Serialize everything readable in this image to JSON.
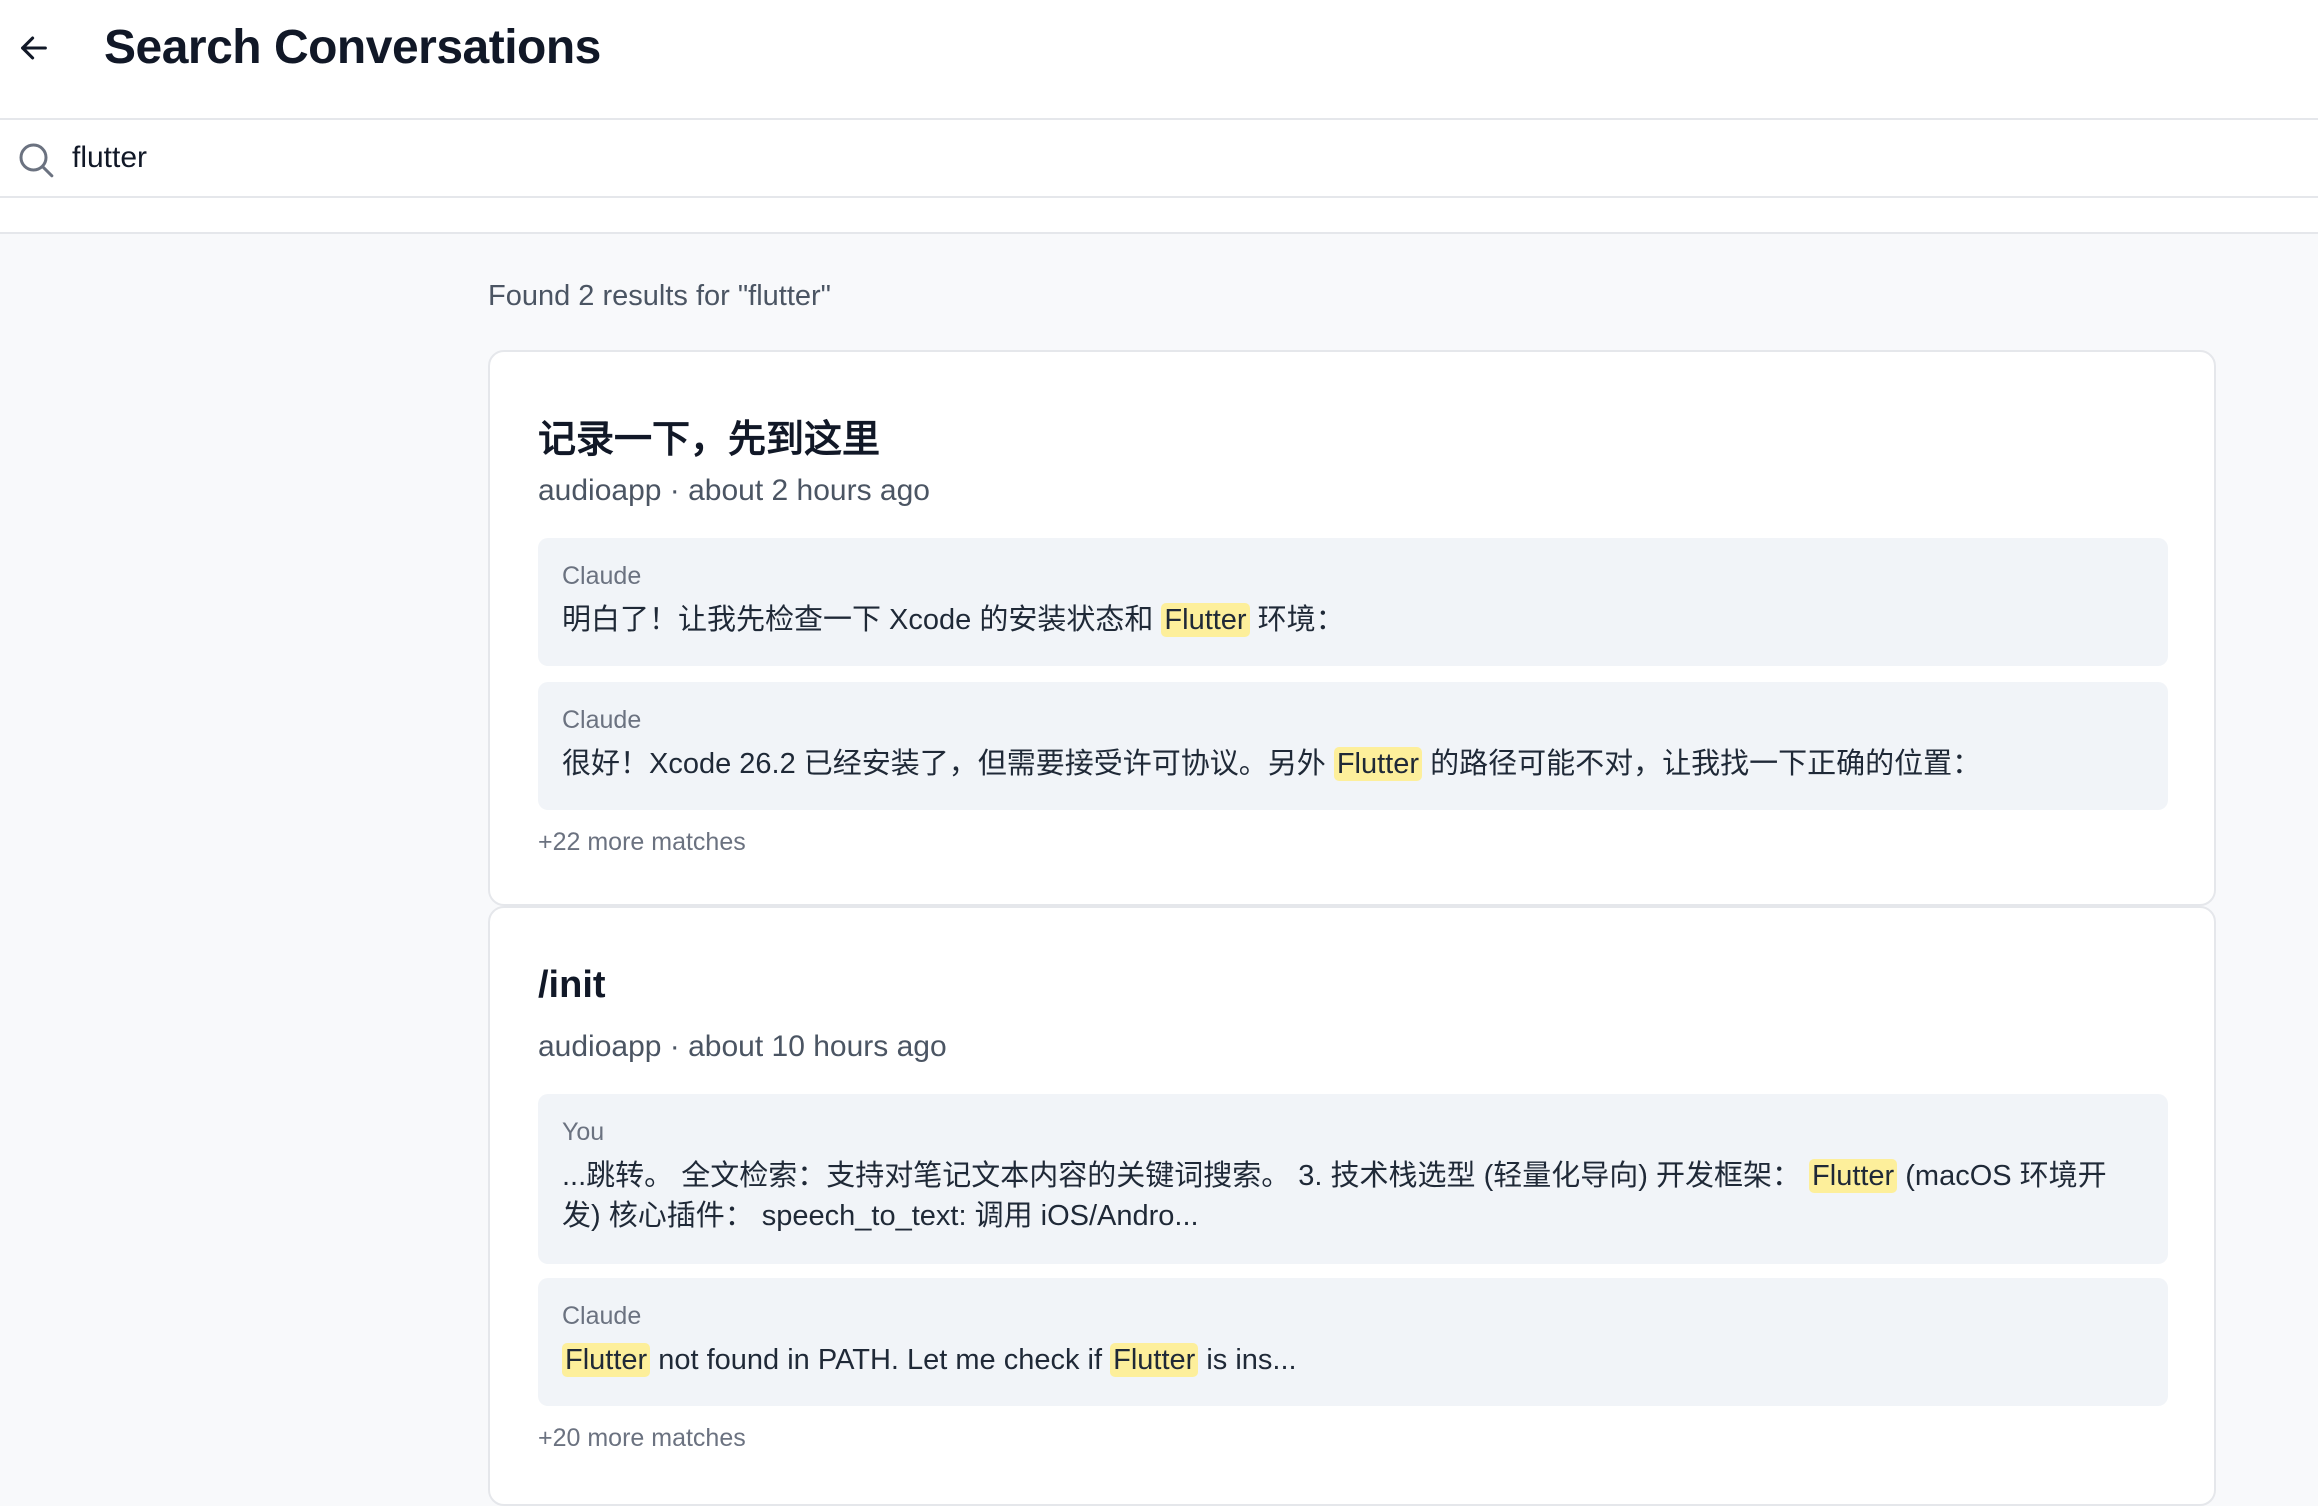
{
  "header": {
    "title": "Search Conversations",
    "back_icon": "arrow-left-icon"
  },
  "search": {
    "icon": "search-icon",
    "value": "flutter",
    "placeholder": ""
  },
  "results": {
    "summary": "Found 2 results for \"flutter\"",
    "items": [
      {
        "title": "记录一下，先到这里",
        "meta": "audioapp · about 2 hours ago",
        "snippets": [
          {
            "role": "Claude",
            "segments": [
              "明白了！让我先检查一下 Xcode 的安装状态和 ",
              "Flutter",
              " 环境："
            ]
          },
          {
            "role": "Claude",
            "segments": [
              "很好！Xcode 26.2 已经安装了，但需要接受许可协议。另外 ",
              "Flutter",
              " 的路径可能不对，让我找一下正确的位置："
            ]
          }
        ],
        "more": "+22 more matches"
      },
      {
        "title": "/init",
        "meta": "audioapp · about 10 hours ago",
        "snippets": [
          {
            "role": "You",
            "segments": [
              "...跳转。 全文检索：支持对笔记文本内容的关键词搜索。 3. 技术栈选型 (轻量化导向) 开发框架： ",
              "Flutter",
              " (macOS 环境开发) 核心插件：  speech_to_text: 调用 iOS/Andro..."
            ]
          },
          {
            "role": "Claude",
            "segments": [
              "",
              "Flutter",
              " not found in PATH. Let me check if ",
              "Flutter",
              " is ins..."
            ]
          }
        ],
        "more": "+20 more matches"
      }
    ]
  },
  "colors": {
    "highlight": "#fdef9b",
    "snippet_bg": "#f1f4f8",
    "page_bg": "#f8f9fb"
  }
}
